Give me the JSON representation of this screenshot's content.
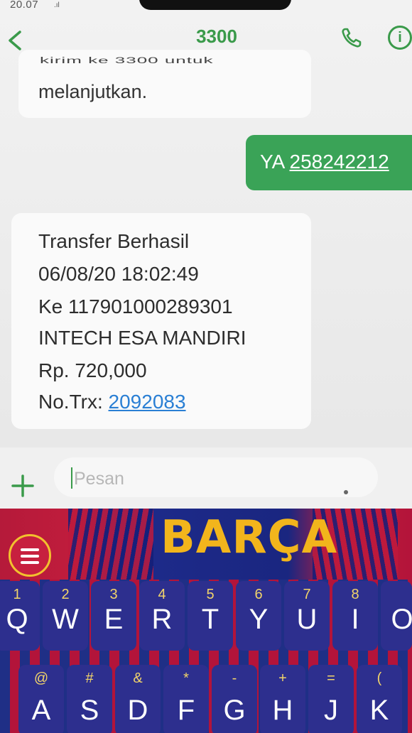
{
  "status": {
    "time": "20.07",
    "signal": ".ıl"
  },
  "header": {
    "title": "3300"
  },
  "messages": {
    "incoming_1_clipped": "kirim ke 3300 untuk",
    "incoming_1_text": "melanjutkan.",
    "outgoing_prefix": "YA ",
    "outgoing_code": "258242212",
    "incoming_2": {
      "line1": "Transfer Berhasil",
      "line2": "06/08/20 18:02:49",
      "line3": "Ke 117901000289301",
      "line4": "INTECH ESA MANDIRI",
      "line5": "Rp. 720,000",
      "line6_prefix": "No.Trx: ",
      "line6_link": "2092083"
    }
  },
  "composer": {
    "placeholder": "Pesan"
  },
  "keyboard": {
    "theme_label": "BARÇA",
    "row1": [
      {
        "num": "1",
        "letter": "Q"
      },
      {
        "num": "2",
        "letter": "W"
      },
      {
        "num": "3",
        "letter": "E"
      },
      {
        "num": "4",
        "letter": "R"
      },
      {
        "num": "5",
        "letter": "T"
      },
      {
        "num": "6",
        "letter": "Y"
      },
      {
        "num": "7",
        "letter": "U"
      },
      {
        "num": "8",
        "letter": "I"
      },
      {
        "num": "",
        "letter": "O"
      }
    ],
    "row2": [
      {
        "sym": "@",
        "letter": "A"
      },
      {
        "sym": "#",
        "letter": "S"
      },
      {
        "sym": "&",
        "letter": "D"
      },
      {
        "sym": "*",
        "letter": "F"
      },
      {
        "sym": "-",
        "letter": "G"
      },
      {
        "sym": "+",
        "letter": "H"
      },
      {
        "sym": "=",
        "letter": "J"
      },
      {
        "sym": "(",
        "letter": "K"
      }
    ]
  },
  "colors": {
    "accent": "#3a9a4a",
    "outgoing": "#3aa357",
    "link": "#2a7fd4",
    "key": "#2d2f8e",
    "gold": "#f2b51c"
  }
}
